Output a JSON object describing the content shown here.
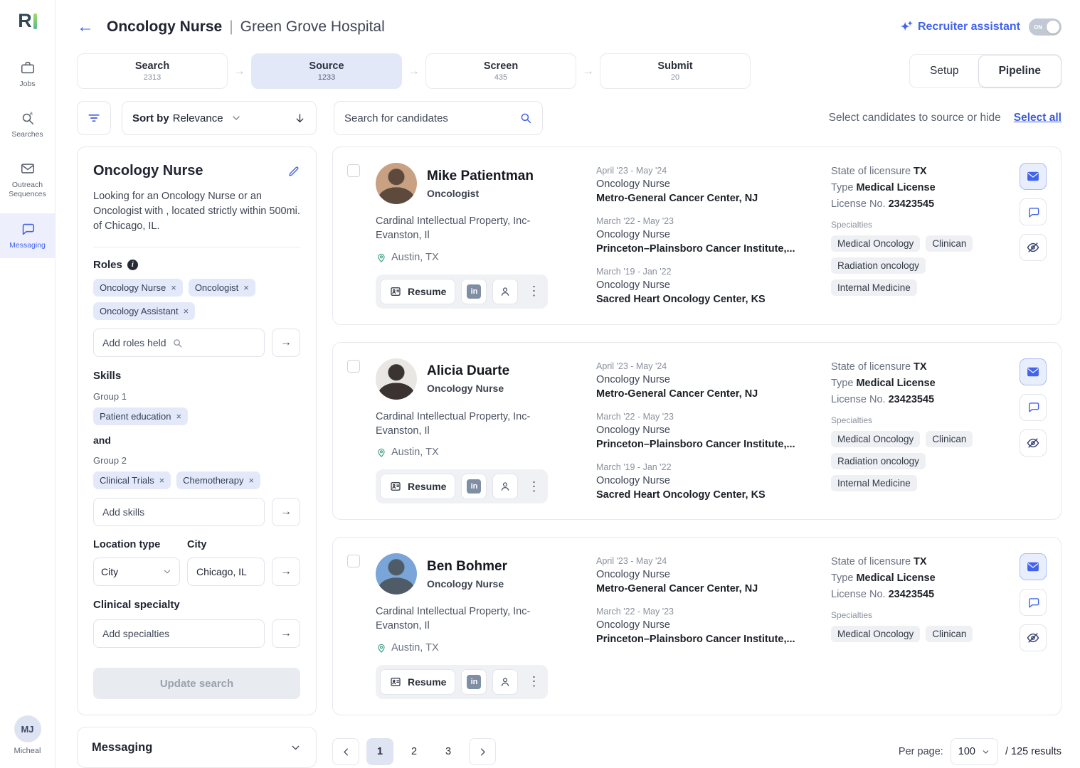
{
  "glyphs": {
    "close": "×",
    "dots_vertical": "⋮",
    "arrow_right": "→",
    "back_arrow": "←",
    "sparkle": "✦",
    "stage_arrow": "→",
    "linkedin": "in"
  },
  "sidebar": {
    "logo_text": "R",
    "items": [
      {
        "label": "Jobs"
      },
      {
        "label": "Searches"
      },
      {
        "label": "Outreach Sequences"
      },
      {
        "label": "Messaging",
        "active": true
      }
    ],
    "user_initials": "MJ",
    "user_name": "Micheal"
  },
  "header": {
    "title": "Oncology Nurse",
    "separator": "|",
    "subtitle": "Green Grove Hospital",
    "assistant_label": "Recruiter assistant",
    "toggle_label": "ON"
  },
  "stages": [
    {
      "label": "Search",
      "count": "2313"
    },
    {
      "label": "Source",
      "count": "1233",
      "active": true
    },
    {
      "label": "Screen",
      "count": "435"
    },
    {
      "label": "Submit",
      "count": "20"
    }
  ],
  "view_switch": {
    "setup": "Setup",
    "pipeline": "Pipeline"
  },
  "toolbar": {
    "sort_by": "Sort by",
    "sort_value": "Relevance",
    "search_placeholder": "Search for candidates",
    "select_hint": "Select candidates to source or hide",
    "select_all": "Select all"
  },
  "panel": {
    "title": "Oncology Nurse",
    "description": "Looking for an Oncology Nurse or an Oncologist with , located strictly within 500mi. of Chicago, IL.",
    "roles_label": "Roles",
    "roles": [
      "Oncology Nurse",
      "Oncologist",
      "Oncology Assistant"
    ],
    "add_roles_placeholder": "Add roles held",
    "skills_label": "Skills",
    "group1_label": "Group 1",
    "group1_chips": [
      "Patient education"
    ],
    "and_label": "and",
    "group2_label": "Group 2",
    "group2_chips": [
      "Clinical Trials",
      "Chemotherapy"
    ],
    "add_skills_placeholder": "Add skills",
    "location_type_label": "Location type",
    "city_label": "City",
    "location_type_value": "City",
    "city_value": "Chicago, IL",
    "specialty_label": "Clinical specialty",
    "add_specialties_placeholder": "Add specialties",
    "update_button": "Update search",
    "messaging_section": "Messaging"
  },
  "candidates": [
    {
      "name": "Mike Patientman",
      "title": "Oncologist",
      "company": "Cardinal Intellectual Property, Inc- Evanston, Il",
      "location": "Austin, TX",
      "resume_label": "Resume",
      "avatar": {
        "bg": "#c8a183",
        "fg": "#5d4a3c"
      },
      "experience": [
        {
          "dates": "April '23 - May '24",
          "role": "Oncology Nurse",
          "org": "Metro-General Cancer Center, NJ"
        },
        {
          "dates": "March '22 - May '23",
          "role": "Oncology Nurse",
          "org": "Princeton–Plainsboro Cancer Institute,..."
        },
        {
          "dates": "March '19 - Jan '22",
          "role": "Oncology Nurse",
          "org": "Sacred Heart Oncology Center, KS"
        }
      ],
      "license_state_label": "State of licensure",
      "license_state": "TX",
      "license_type_label": "Type",
      "license_type": "Medical License",
      "license_no_label": "License No.",
      "license_no": "23423545",
      "specialties_label": "Specialties",
      "specialties": [
        "Medical Oncology",
        "Clinican",
        "Radiation oncology",
        "Internal Medicine"
      ]
    },
    {
      "name": "Alicia Duarte",
      "title": "Oncology Nurse",
      "company": "Cardinal Intellectual Property, Inc- Evanston, Il",
      "location": "Austin, TX",
      "resume_label": "Resume",
      "avatar": {
        "bg": "#e9e7e4",
        "fg": "#3a3331"
      },
      "experience": [
        {
          "dates": "April '23 - May '24",
          "role": "Oncology Nurse",
          "org": "Metro-General Cancer Center, NJ"
        },
        {
          "dates": "March '22 - May '23",
          "role": "Oncology Nurse",
          "org": "Princeton–Plainsboro Cancer Institute,..."
        },
        {
          "dates": "March '19 - Jan '22",
          "role": "Oncology Nurse",
          "org": "Sacred Heart Oncology Center, KS"
        }
      ],
      "license_state_label": "State of licensure",
      "license_state": "TX",
      "license_type_label": "Type",
      "license_type": "Medical License",
      "license_no_label": "License No.",
      "license_no": "23423545",
      "specialties_label": "Specialties",
      "specialties": [
        "Medical Oncology",
        "Clinican",
        "Radiation oncology",
        "Internal Medicine"
      ]
    },
    {
      "name": "Ben Bohmer",
      "title": "Oncology Nurse",
      "company": "Cardinal Intellectual Property, Inc- Evanston, Il",
      "location": "Austin, TX",
      "resume_label": "Resume",
      "avatar": {
        "bg": "#79a5d8",
        "fg": "#4f5b66"
      },
      "experience": [
        {
          "dates": "April '23 - May '24",
          "role": "Oncology Nurse",
          "org": "Metro-General Cancer Center, NJ"
        },
        {
          "dates": "March '22 - May '23",
          "role": "Oncology Nurse",
          "org": "Princeton–Plainsboro Cancer Institute,..."
        }
      ],
      "license_state_label": "State of licensure",
      "license_state": "TX",
      "license_type_label": "Type",
      "license_type": "Medical License",
      "license_no_label": "License No.",
      "license_no": "23423545",
      "specialties_label": "Specialties",
      "specialties": [
        "Medical Oncology",
        "Clinican"
      ]
    }
  ],
  "pagination": {
    "pages": [
      "1",
      "2",
      "3"
    ],
    "current": "1",
    "per_page_label": "Per page:",
    "per_page_value": "100",
    "results_suffix": "/ 125 results"
  },
  "colors": {
    "accent": "#4263eb",
    "chip_bg": "#e4e9fa",
    "stage_active_bg": "#e3e8f8"
  }
}
